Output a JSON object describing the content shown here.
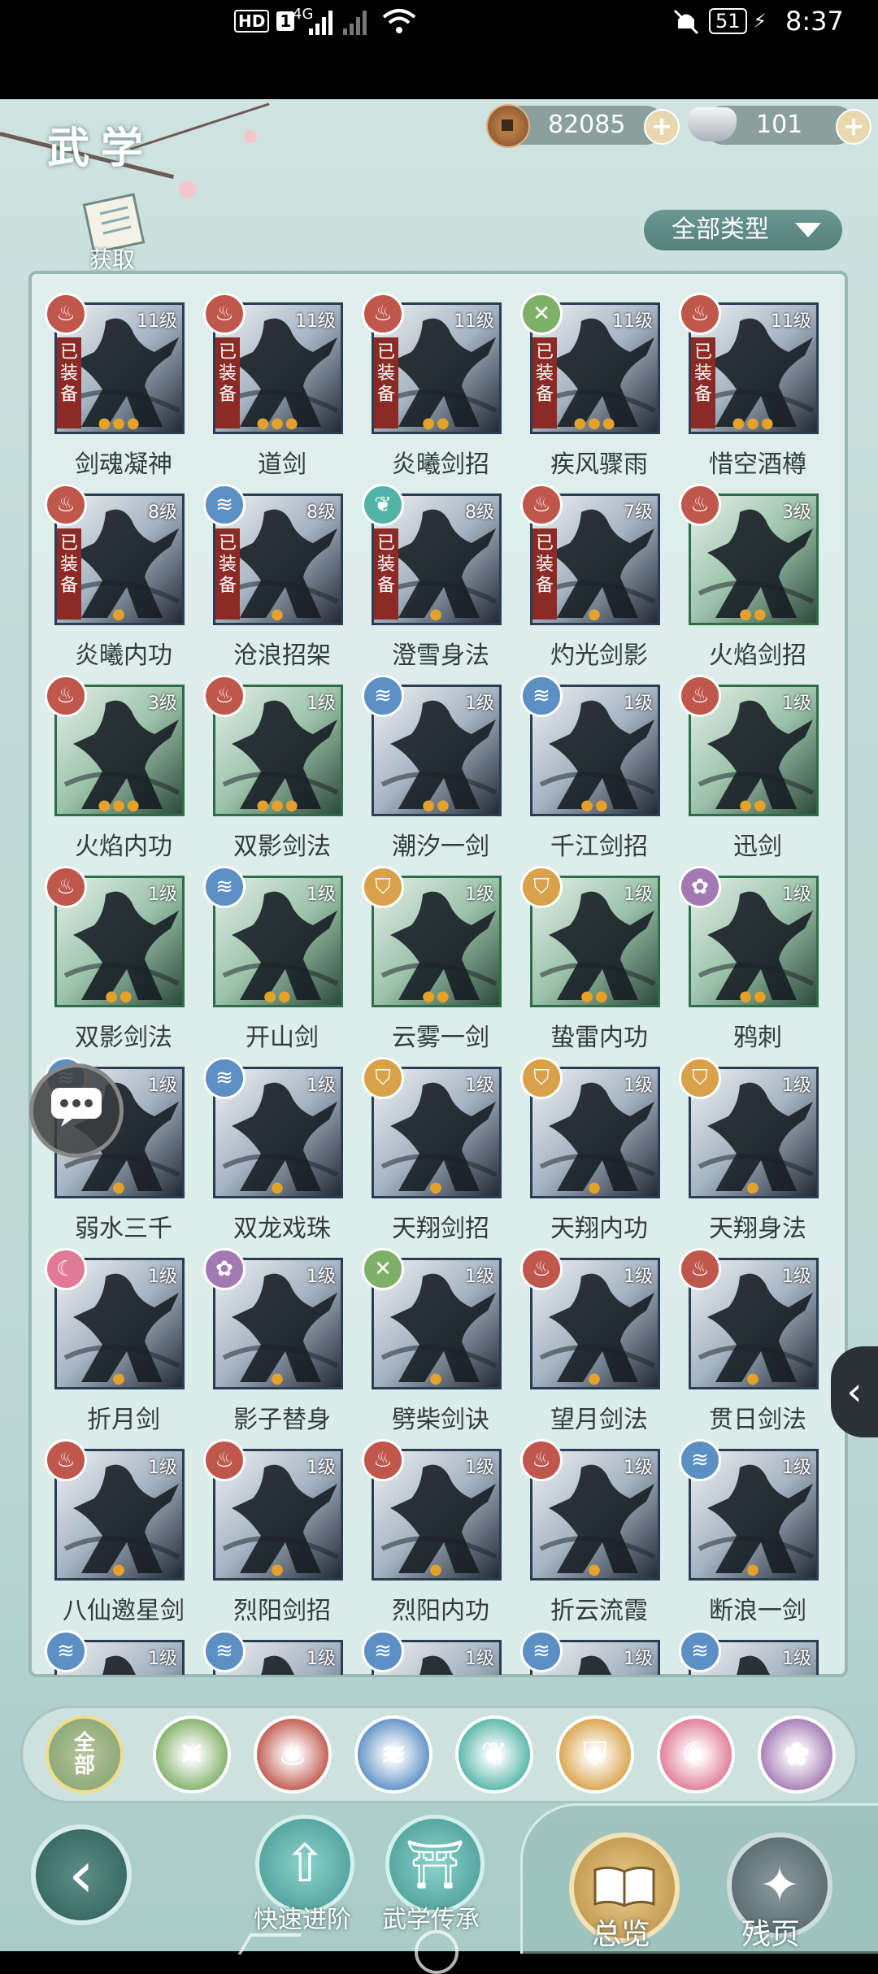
{
  "status_bar": {
    "hd_label": "HD",
    "sim1": "1",
    "network": "4G",
    "battery": "51",
    "time": "8:37"
  },
  "header": {
    "title": "武学",
    "copper_amount": "82085",
    "silver_amount": "101",
    "plus_symbol": "+",
    "get_label": "获取",
    "type_filter": "全部类型"
  },
  "equipped_text": "已装备",
  "skills": [
    {
      "name": "剑魂凝神",
      "level": "11级",
      "element": "fire",
      "equipped": true,
      "stars": 3,
      "frame": "blue"
    },
    {
      "name": "道剑",
      "level": "11级",
      "element": "fire",
      "equipped": true,
      "stars": 3,
      "frame": "blue"
    },
    {
      "name": "炎曦剑招",
      "level": "11级",
      "element": "fire",
      "equipped": true,
      "stars": 2,
      "frame": "blue"
    },
    {
      "name": "疾风骤雨",
      "level": "11级",
      "element": "wind",
      "equipped": true,
      "stars": 3,
      "frame": "blue"
    },
    {
      "name": "惜空酒樽",
      "level": "11级",
      "element": "fire",
      "equipped": true,
      "stars": 3,
      "frame": "blue"
    },
    {
      "name": "炎曦内功",
      "level": "8级",
      "element": "fire",
      "equipped": true,
      "stars": 1,
      "frame": "blue"
    },
    {
      "name": "沧浪招架",
      "level": "8级",
      "element": "water",
      "equipped": true,
      "stars": 1,
      "frame": "blue"
    },
    {
      "name": "澄雪身法",
      "level": "8级",
      "element": "leaf",
      "equipped": true,
      "stars": 1,
      "frame": "blue"
    },
    {
      "name": "灼光剑影",
      "level": "7级",
      "element": "fire",
      "equipped": true,
      "stars": 1,
      "frame": "blue"
    },
    {
      "name": "火焰剑招",
      "level": "3级",
      "element": "fire",
      "equipped": false,
      "stars": 2,
      "frame": "green"
    },
    {
      "name": "火焰内功",
      "level": "3级",
      "element": "fire",
      "equipped": false,
      "stars": 3,
      "frame": "green"
    },
    {
      "name": "双影剑法",
      "level": "1级",
      "element": "fire",
      "equipped": false,
      "stars": 3,
      "frame": "green"
    },
    {
      "name": "潮汐一剑",
      "level": "1级",
      "element": "water",
      "equipped": false,
      "stars": 2,
      "frame": "blue"
    },
    {
      "name": "千江剑招",
      "level": "1级",
      "element": "water",
      "equipped": false,
      "stars": 2,
      "frame": "blue"
    },
    {
      "name": "迅剑",
      "level": "1级",
      "element": "fire",
      "equipped": false,
      "stars": 2,
      "frame": "green"
    },
    {
      "name": "双影剑法",
      "level": "1级",
      "element": "fire",
      "equipped": false,
      "stars": 2,
      "frame": "green"
    },
    {
      "name": "开山剑",
      "level": "1级",
      "element": "water",
      "equipped": false,
      "stars": 2,
      "frame": "green"
    },
    {
      "name": "云雾一剑",
      "level": "1级",
      "element": "shield",
      "equipped": false,
      "stars": 2,
      "frame": "green"
    },
    {
      "name": "蛰雷内功",
      "level": "1级",
      "element": "shield",
      "equipped": false,
      "stars": 2,
      "frame": "green"
    },
    {
      "name": "鸦刺",
      "level": "1级",
      "element": "rose",
      "equipped": false,
      "stars": 2,
      "frame": "green"
    },
    {
      "name": "弱水三千",
      "level": "1级",
      "element": "water",
      "equipped": false,
      "stars": 1,
      "frame": "blue"
    },
    {
      "name": "双龙戏珠",
      "level": "1级",
      "element": "water",
      "equipped": false,
      "stars": 1,
      "frame": "blue"
    },
    {
      "name": "天翔剑招",
      "level": "1级",
      "element": "shield",
      "equipped": false,
      "stars": 1,
      "frame": "blue"
    },
    {
      "name": "天翔内功",
      "level": "1级",
      "element": "shield",
      "equipped": false,
      "stars": 1,
      "frame": "blue"
    },
    {
      "name": "天翔身法",
      "level": "1级",
      "element": "shield",
      "equipped": false,
      "stars": 1,
      "frame": "blue"
    },
    {
      "name": "折月剑",
      "level": "1级",
      "element": "moon",
      "equipped": false,
      "stars": 1,
      "frame": "blue"
    },
    {
      "name": "影子替身",
      "level": "1级",
      "element": "rose",
      "equipped": false,
      "stars": 1,
      "frame": "blue"
    },
    {
      "name": "劈柴剑诀",
      "level": "1级",
      "element": "wind",
      "equipped": false,
      "stars": 1,
      "frame": "blue"
    },
    {
      "name": "望月剑法",
      "level": "1级",
      "element": "fire",
      "equipped": false,
      "stars": 1,
      "frame": "blue"
    },
    {
      "name": "贯日剑法",
      "level": "1级",
      "element": "fire",
      "equipped": false,
      "stars": 1,
      "frame": "blue"
    },
    {
      "name": "八仙邀星剑",
      "level": "1级",
      "element": "fire",
      "equipped": false,
      "stars": 1,
      "frame": "blue"
    },
    {
      "name": "烈阳剑招",
      "level": "1级",
      "element": "fire",
      "equipped": false,
      "stars": 1,
      "frame": "blue"
    },
    {
      "name": "烈阳内功",
      "level": "1级",
      "element": "fire",
      "equipped": false,
      "stars": 1,
      "frame": "blue"
    },
    {
      "name": "折云流霞",
      "level": "1级",
      "element": "fire",
      "equipped": false,
      "stars": 1,
      "frame": "blue"
    },
    {
      "name": "断浪一剑",
      "level": "1级",
      "element": "water",
      "equipped": false,
      "stars": 1,
      "frame": "blue"
    },
    {
      "name": "",
      "level": "1级",
      "element": "water",
      "equipped": false,
      "stars": 0,
      "frame": "blue"
    },
    {
      "name": "",
      "level": "1级",
      "element": "water",
      "equipped": false,
      "stars": 0,
      "frame": "blue"
    },
    {
      "name": "",
      "level": "1级",
      "element": "water",
      "equipped": false,
      "stars": 0,
      "frame": "blue"
    },
    {
      "name": "",
      "level": "1级",
      "element": "water",
      "equipped": false,
      "stars": 0,
      "frame": "blue"
    },
    {
      "name": "",
      "level": "1级",
      "element": "water",
      "equipped": false,
      "stars": 0,
      "frame": "blue"
    }
  ],
  "element_colors": {
    "fire": "#c0574c",
    "water": "#5c8fc4",
    "wind": "#7fb067",
    "leaf": "#52b4a6",
    "shield": "#d9a24a",
    "moon": "#e07a96",
    "rose": "#a379b3"
  },
  "filter_bar": {
    "all_label": "全部",
    "element_icons": [
      "wind-icon",
      "fire-icon",
      "water-icon",
      "leaf-icon",
      "shield-icon",
      "moon-icon",
      "rose-icon"
    ]
  },
  "bottom_nav": {
    "quick_advance": "快速进阶",
    "inherit": "武学传承",
    "overview": "总览",
    "fragments": "残页"
  }
}
